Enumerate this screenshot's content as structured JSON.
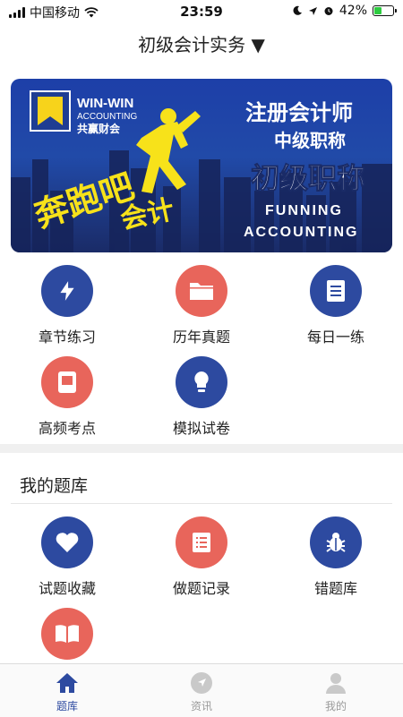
{
  "status_bar": {
    "carrier": "中国移动",
    "time": "23:59",
    "battery": "42%",
    "battery_level": 0.42
  },
  "header": {
    "title": "初级会计实务 ▼"
  },
  "banner": {
    "brand_en": "WIN-WIN",
    "brand_sub": "ACCOUNTING",
    "brand_cn": "共赢财会",
    "slogan_big": "奔跑吧",
    "slogan_small": "会计",
    "line1": "注册会计师",
    "line2": "中级职称",
    "line3": "初级职称",
    "en1": "FUNNING",
    "en2": "ACCOUNTING"
  },
  "features": [
    {
      "label": "章节练习",
      "icon": "lightning-icon",
      "color": "#2d4aa0"
    },
    {
      "label": "历年真题",
      "icon": "folder-icon",
      "color": "#e8655b"
    },
    {
      "label": "每日一练",
      "icon": "document-icon",
      "color": "#2d4aa0"
    },
    {
      "label": "高频考点",
      "icon": "notebook-icon",
      "color": "#e8655b"
    },
    {
      "label": "模拟试卷",
      "icon": "lightbulb-icon",
      "color": "#2d4aa0"
    }
  ],
  "my_bank": {
    "title": "我的题库",
    "items": [
      {
        "label": "试题收藏",
        "icon": "heart-icon",
        "color": "#2d4aa0"
      },
      {
        "label": "做题记录",
        "icon": "list-icon",
        "color": "#e8655b"
      },
      {
        "label": "错题库",
        "icon": "bug-icon",
        "color": "#2d4aa0"
      },
      {
        "label": "",
        "icon": "book-icon",
        "color": "#e8655b"
      }
    ]
  },
  "tabs": [
    {
      "label": "题库",
      "icon": "home-icon",
      "active": true
    },
    {
      "label": "资讯",
      "icon": "compass-icon",
      "active": false
    },
    {
      "label": "我的",
      "icon": "person-icon",
      "active": false
    }
  ]
}
